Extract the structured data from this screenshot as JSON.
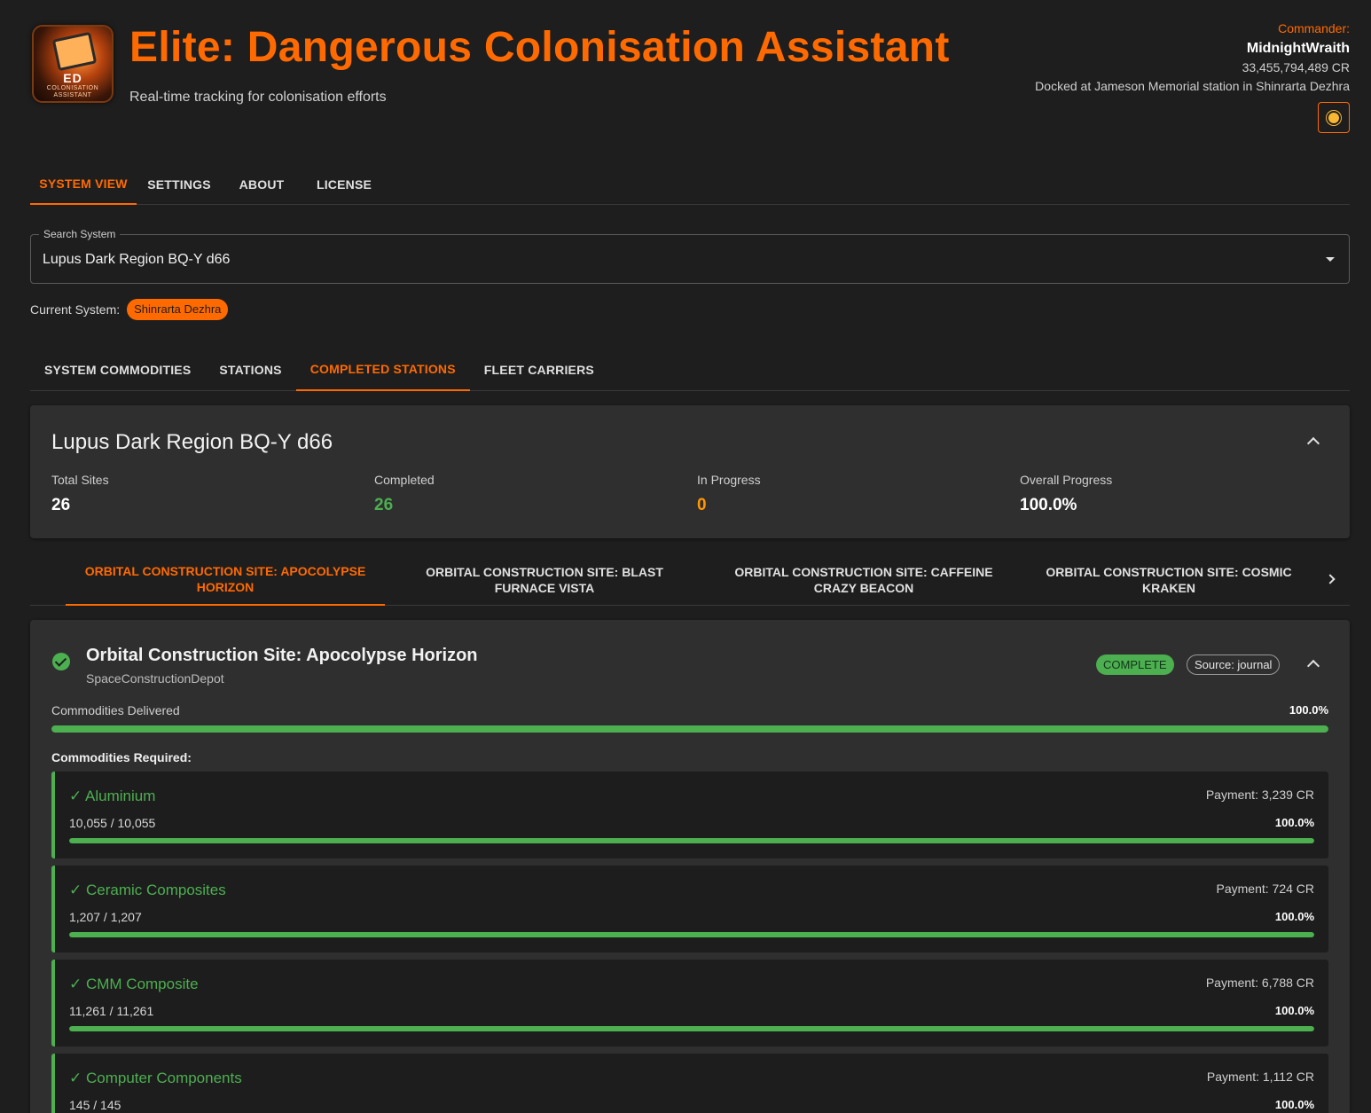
{
  "header": {
    "logo_text": "ED",
    "logo_sub": "COLONISATION ASSISTANT",
    "title": "Elite: Dangerous Colonisation Assistant",
    "subtitle": "Real-time tracking for colonisation efforts",
    "theme_icon": "sun-icon"
  },
  "commander": {
    "label": "Commander:",
    "name": "MidnightWraith",
    "credits": "33,455,794,489 CR",
    "status": "Docked at Jameson Memorial station in Shinrarta Dezhra"
  },
  "main_tabs": [
    {
      "label": "SYSTEM VIEW",
      "active": true
    },
    {
      "label": "SETTINGS",
      "active": false
    },
    {
      "label": "ABOUT",
      "active": false
    },
    {
      "label": "LICENSE",
      "active": false
    }
  ],
  "search": {
    "label": "Search System",
    "value": "Lupus Dark Region BQ-Y d66"
  },
  "current_system": {
    "label": "Current System:",
    "value": "Shinrarta Dezhra"
  },
  "sub_tabs": [
    {
      "label": "SYSTEM COMMODITIES",
      "active": false
    },
    {
      "label": "STATIONS",
      "active": false
    },
    {
      "label": "COMPLETED STATIONS",
      "active": true
    },
    {
      "label": "FLEET CARRIERS",
      "active": false
    }
  ],
  "summary": {
    "system_name": "Lupus Dark Region BQ-Y d66",
    "stats": [
      {
        "label": "Total Sites",
        "value": "26",
        "color": "#ffffff"
      },
      {
        "label": "Completed",
        "value": "26",
        "color": "#4caf50"
      },
      {
        "label": "In Progress",
        "value": "0",
        "color": "#ff9800"
      },
      {
        "label": "Overall Progress",
        "value": "100.0%",
        "color": "#ffffff"
      }
    ]
  },
  "station_tabs": [
    {
      "label": "ORBITAL CONSTRUCTION SITE: APOCOLYPSE HORIZON",
      "active": true
    },
    {
      "label": "ORBITAL CONSTRUCTION SITE: BLAST FURNACE VISTA",
      "active": false
    },
    {
      "label": "ORBITAL CONSTRUCTION SITE: CAFFEINE CRAZY BEACON",
      "active": false
    },
    {
      "label": "ORBITAL CONSTRUCTION SITE: COSMIC KRAKEN",
      "active": false
    }
  ],
  "station": {
    "name": "Orbital Construction Site: Apocolypse Horizon",
    "type": "SpaceConstructionDepot",
    "status_badge": "COMPLETE",
    "source_badge": "Source: journal",
    "delivered_label": "Commodities Delivered",
    "delivered_pct": "100.0%",
    "delivered_fraction": 1.0,
    "required_label": "Commodities Required:",
    "commodities": [
      {
        "name": "✓ Aluminium",
        "payment": "Payment: 3,239 CR",
        "qty": "10,055 / 10,055",
        "pct": "100.0%",
        "fraction": 1.0
      },
      {
        "name": "✓ Ceramic Composites",
        "payment": "Payment: 724 CR",
        "qty": "1,207 / 1,207",
        "pct": "100.0%",
        "fraction": 1.0
      },
      {
        "name": "✓ CMM Composite",
        "payment": "Payment: 6,788 CR",
        "qty": "11,261 / 11,261",
        "pct": "100.0%",
        "fraction": 1.0
      },
      {
        "name": "✓ Computer Components",
        "payment": "Payment: 1,112 CR",
        "qty": "145 / 145",
        "pct": "100.0%",
        "fraction": 1.0
      }
    ]
  },
  "colors": {
    "accent": "#ff6a00",
    "success": "#4caf50",
    "warning": "#ff9800",
    "background": "#1e1e1e",
    "card": "#2f2f2f"
  }
}
